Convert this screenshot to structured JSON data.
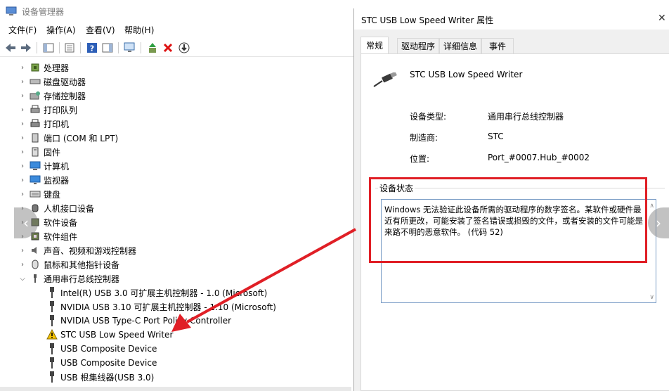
{
  "window": {
    "title": "设备管理器"
  },
  "menu": [
    {
      "label": "文件(F)"
    },
    {
      "label": "操作(A)"
    },
    {
      "label": "查看(V)"
    },
    {
      "label": "帮助(H)"
    }
  ],
  "tree": {
    "categories": [
      {
        "label": "处理器",
        "icon": "cpu-icon"
      },
      {
        "label": "磁盘驱动器",
        "icon": "disk-icon"
      },
      {
        "label": "存储控制器",
        "icon": "storage-icon"
      },
      {
        "label": "打印队列",
        "icon": "print-queue-icon"
      },
      {
        "label": "打印机",
        "icon": "printer-icon"
      },
      {
        "label": "端口 (COM 和 LPT)",
        "icon": "port-icon"
      },
      {
        "label": "固件",
        "icon": "firmware-icon"
      },
      {
        "label": "计算机",
        "icon": "computer-icon"
      },
      {
        "label": "监视器",
        "icon": "monitor-icon"
      },
      {
        "label": "键盘",
        "icon": "keyboard-icon"
      },
      {
        "label": "人机接口设备",
        "icon": "hid-icon"
      },
      {
        "label": "软件设备",
        "icon": "software-device-icon"
      },
      {
        "label": "软件组件",
        "icon": "software-component-icon"
      },
      {
        "label": "声音、视频和游戏控制器",
        "icon": "sound-icon"
      },
      {
        "label": "鼠标和其他指针设备",
        "icon": "mouse-icon"
      },
      {
        "label": "通用串行总线控制器",
        "icon": "usb-icon"
      }
    ],
    "usb_children": [
      {
        "label": "Intel(R) USB 3.0 可扩展主机控制器 - 1.0 (Microsoft)",
        "warning": false
      },
      {
        "label": "NVIDIA USB 3.10 可扩展主机控制器 - 1.10 (Microsoft)",
        "warning": false
      },
      {
        "label": "NVIDIA USB Type-C Port Policy Controller",
        "warning": false
      },
      {
        "label": "STC USB Low Speed Writer",
        "warning": true
      },
      {
        "label": "USB Composite Device",
        "warning": false
      },
      {
        "label": "USB Composite Device",
        "warning": false
      },
      {
        "label": "USB 根集线器(USB 3.0)",
        "warning": false
      }
    ]
  },
  "dialog": {
    "title": "STC USB Low Speed Writer 属性",
    "tabs": [
      {
        "label": "常规"
      },
      {
        "label": "驱动程序"
      },
      {
        "label": "详细信息"
      },
      {
        "label": "事件"
      }
    ],
    "device_name": "STC USB Low Speed Writer",
    "props": [
      {
        "label": "设备类型:",
        "value": "通用串行总线控制器"
      },
      {
        "label": "制造商:",
        "value": "STC"
      },
      {
        "label": "位置:",
        "value": "Port_#0007.Hub_#0002"
      }
    ],
    "status_group_label": "设备状态",
    "status_text": "Windows 无法验证此设备所需的驱动程序的数字签名。某软件或硬件最近有所更改，可能安装了签名错误或损毁的文件，或者安装的文件可能是来路不明的恶意软件。 (代码 52)"
  },
  "colors": {
    "highlight": "#e01f26",
    "warning": "#f5c200"
  }
}
